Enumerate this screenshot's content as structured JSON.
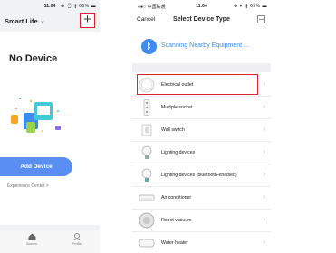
{
  "left_phone": {
    "status": {
      "time": "11:04",
      "battery": "65%"
    },
    "title": "Smart Life",
    "title_chevron": "⌄",
    "add_symbol": "+",
    "no_device_text": "No Device",
    "add_device_label": "Add Device",
    "experience_center_label": "Experience Center >",
    "tabs": [
      {
        "label": "Scenes",
        "icon": "home-icon"
      },
      {
        "label": "Profile",
        "icon": "profile-icon"
      }
    ]
  },
  "right_phone": {
    "status": {
      "carrier": "●●○ 中国联通 ",
      "time": "11:04",
      "battery": "65%"
    },
    "cancel_label": "Cancel",
    "title": "Select Device Type",
    "scanning_label": "Scanning Nearby Equipment ...",
    "bluetooth_glyph": "ᛒ",
    "devices": [
      {
        "label": "Electrical outlet",
        "icon": "outlet-icon"
      },
      {
        "label": "Multiple socket",
        "icon": "power-strip-icon"
      },
      {
        "label": "Wall switch",
        "icon": "wall-switch-icon"
      },
      {
        "label": "Lighting devices",
        "icon": "bulb-icon"
      },
      {
        "label": "Lighting devices (bluetooth-enabled)",
        "icon": "bluetooth-bulb-icon"
      },
      {
        "label": "Air conditioner",
        "icon": "air-conditioner-icon"
      },
      {
        "label": "Robot vacuum",
        "icon": "robot-vacuum-icon"
      },
      {
        "label": "Water heater",
        "icon": "water-heater-icon"
      }
    ],
    "chevron": "›"
  },
  "colors": {
    "accent_blue": "#5b8ef2",
    "bluetooth_blue": "#3d8cf0",
    "highlight_red": "#d8222d"
  }
}
